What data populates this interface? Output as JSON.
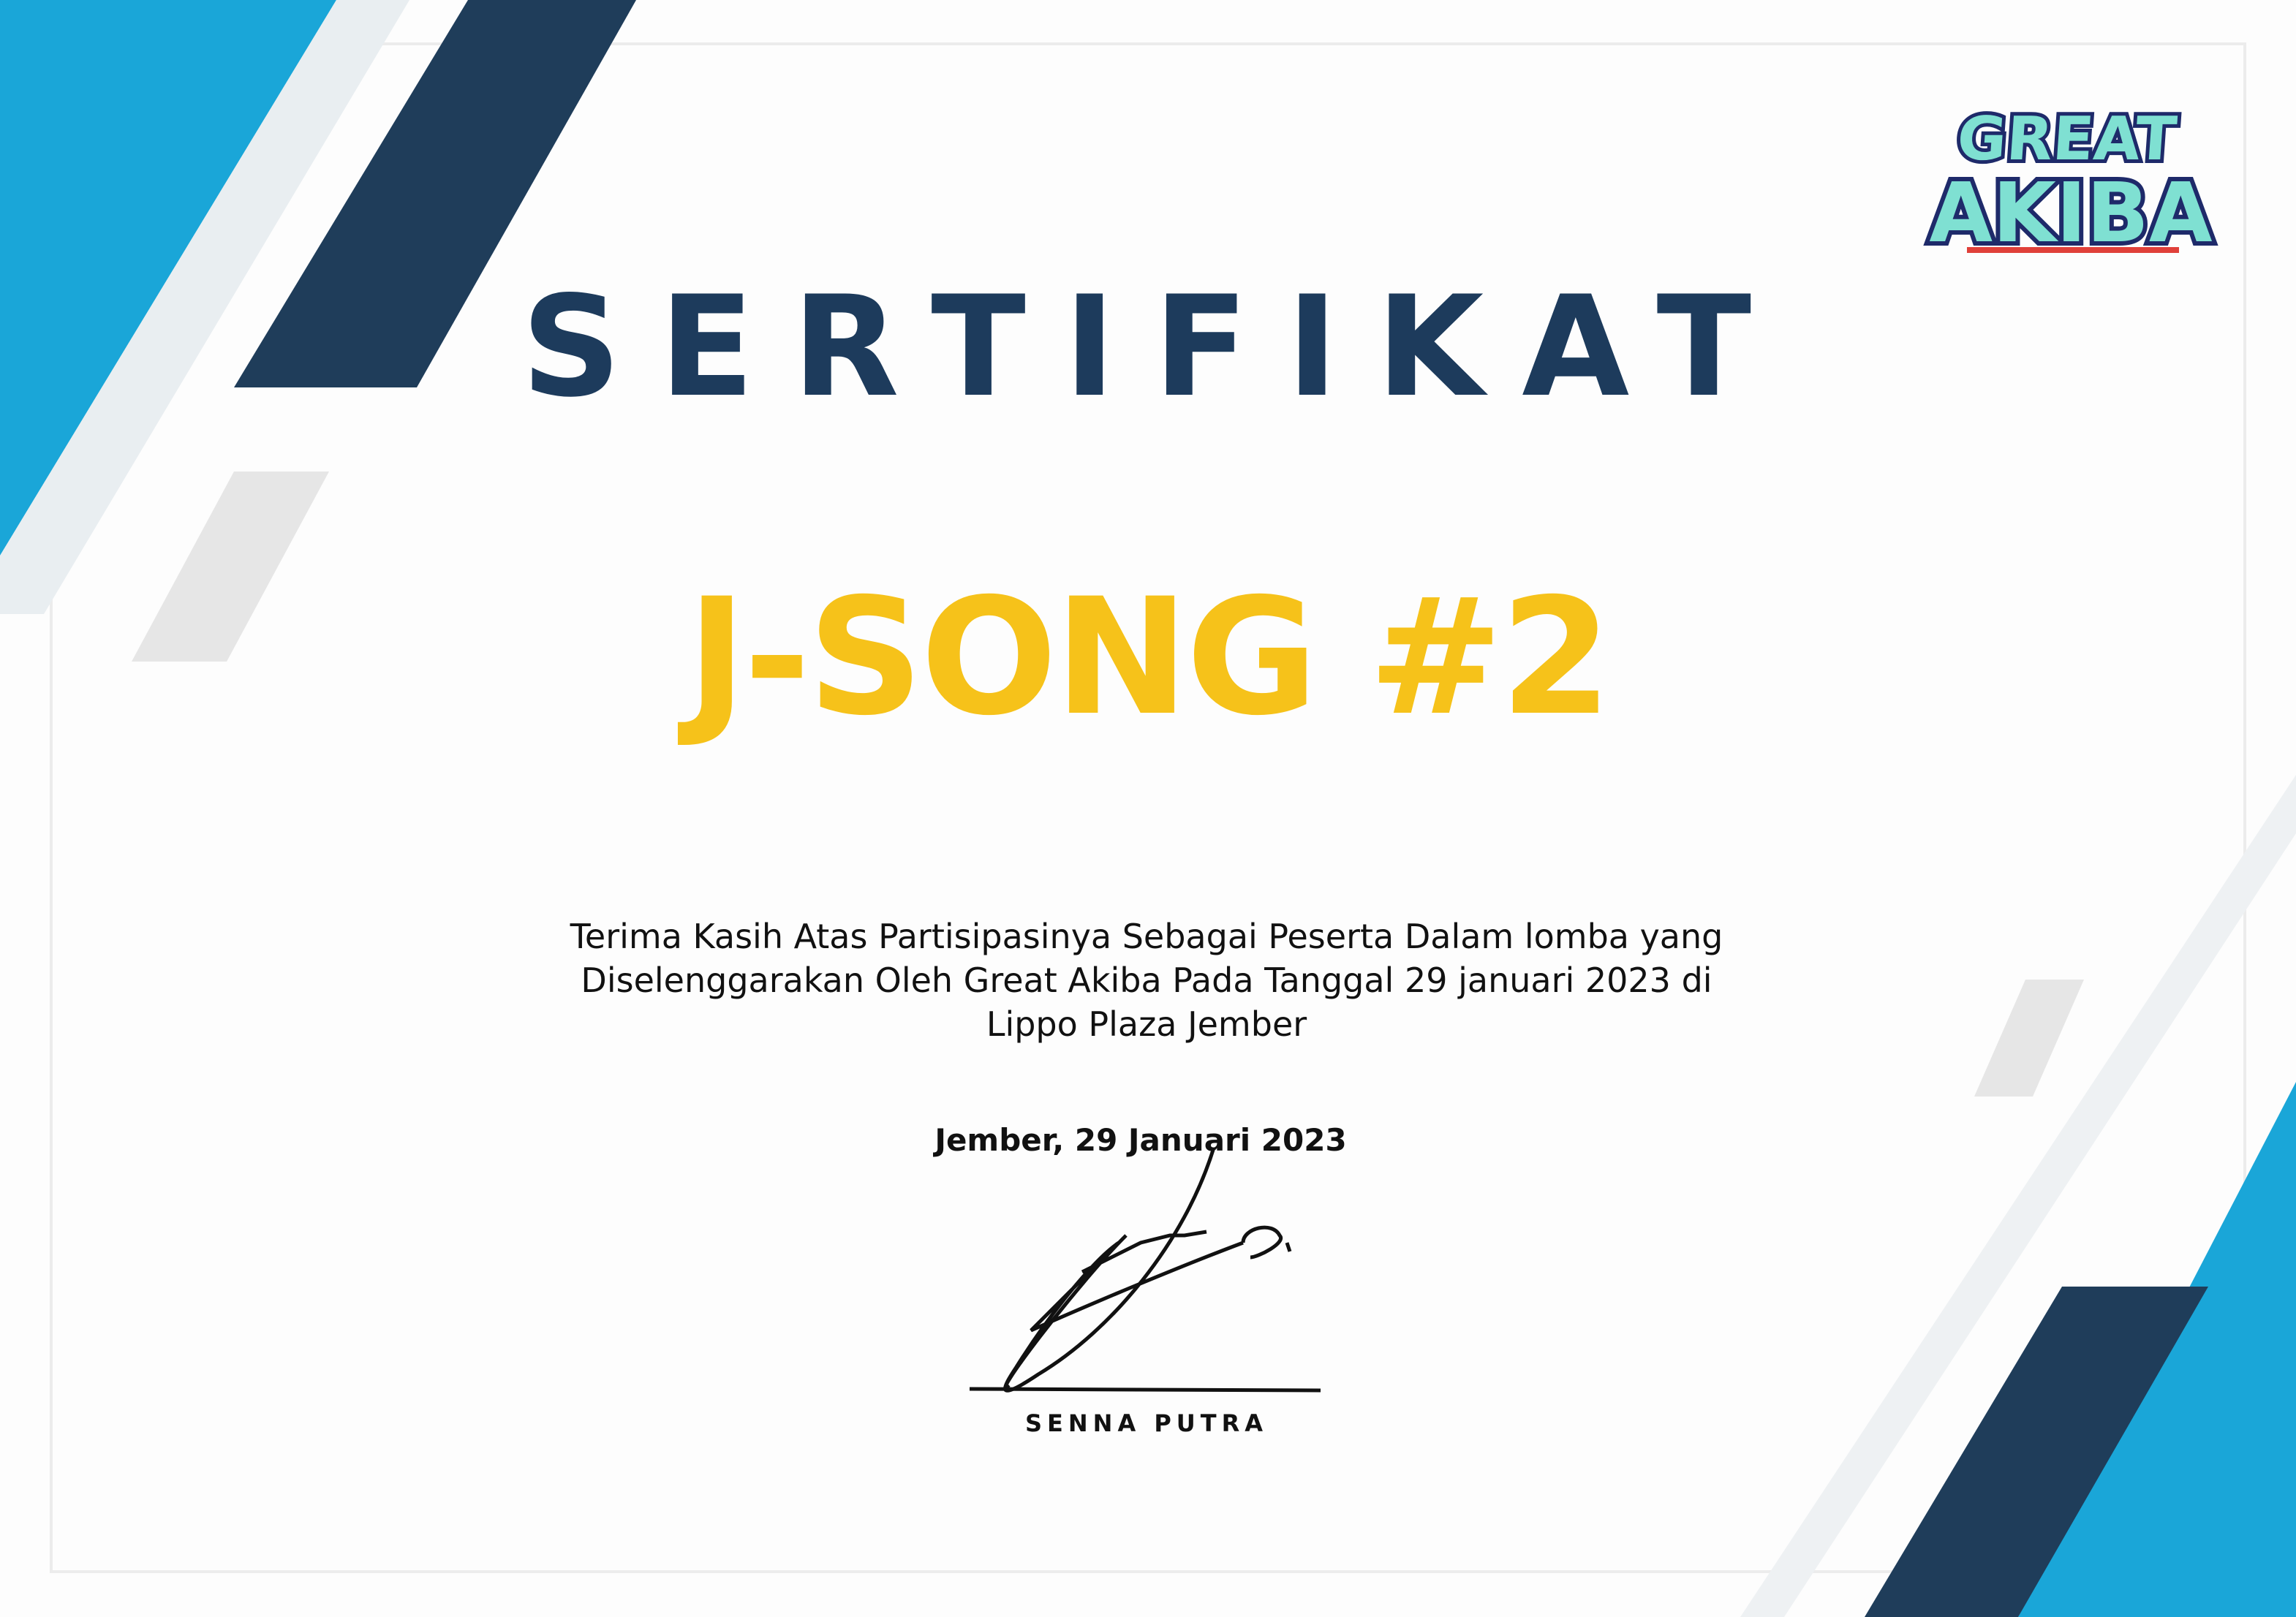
{
  "certificate": {
    "title": "SERTIFIKAT",
    "event": "J-SONG #2",
    "message_lines": [
      "Terima Kasih Atas Partisipasinya Sebagai Peserta Dalam lomba yang",
      "Diselenggarakan Oleh Great Akiba Pada Tanggal 29 januari 2023 di",
      "Lippo Plaza Jember"
    ],
    "place_date": "Jember, 29 Januari 2023",
    "signatory": "SENNA PUTRA"
  },
  "logo": {
    "line1": "GREAT",
    "line2": "AKIBA"
  },
  "colors": {
    "accent_cyan": "#1aa6d8",
    "navy": "#1d3b5c",
    "yellow": "#f6c21a",
    "logo_teal": "#7fe0d2"
  }
}
